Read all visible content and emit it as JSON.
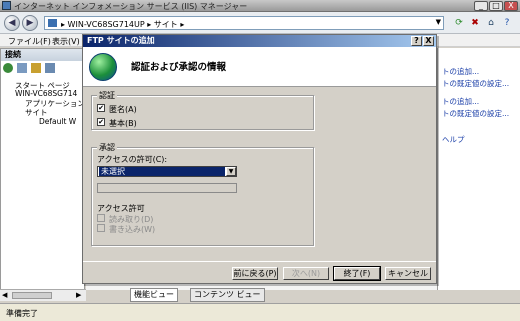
{
  "window": {
    "title": "インターネット インフォメーション サービス (IIS) マネージャー",
    "controls": [
      "_",
      "□",
      "X"
    ]
  },
  "address": {
    "path": "▸ WIN-VC68SG714UP ▸ サイト ▸"
  },
  "menu": {
    "items": [
      "ファイル(F)",
      "表示(V)"
    ]
  },
  "left": {
    "header": "接続",
    "tree": [
      "スタート ページ",
      "WIN-VC68SG714",
      "アプリケーション",
      "サイト",
      "Default W"
    ]
  },
  "right": {
    "actions": [
      "トの追加...",
      "トの既定値の設定...",
      "トの追加...",
      "トの既定値の設定...",
      "ヘルプ"
    ]
  },
  "views": {
    "features": "機能ビュー",
    "content": "コンテンツ ビュー"
  },
  "status": {
    "text": "準備完了"
  },
  "dialog": {
    "title": "FTP サイトの追加",
    "title_controls": [
      "?",
      "X"
    ],
    "heading": "認証および承認の情報",
    "auth": {
      "label": "認証",
      "anonymous": "匿名(A)",
      "basic": "基本(B)",
      "anonymous_checked": true,
      "basic_checked": true
    },
    "authz": {
      "label": "承認",
      "access_label": "アクセスの許可(C):",
      "access_value": "未選択",
      "perm_label": "アクセス許可",
      "read": "読み取り(D)",
      "write": "書き込み(W)"
    },
    "buttons": {
      "prev": "前に戻る(P)",
      "next": "次へ(N)",
      "finish": "終了(F)",
      "cancel": "キャンセル"
    }
  }
}
